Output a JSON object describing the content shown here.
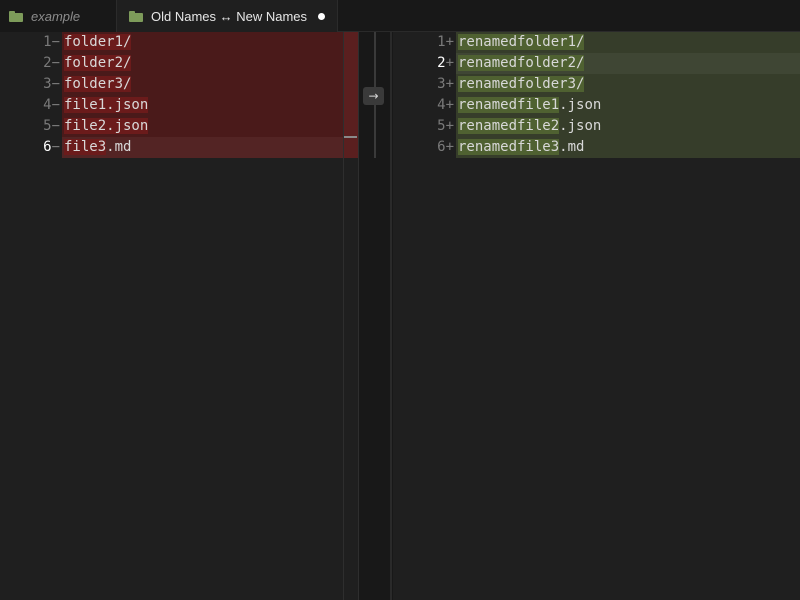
{
  "tabs": [
    {
      "label": "example",
      "icon": "folder-icon",
      "active": false
    },
    {
      "label": "Old Names ↔ New Names",
      "icon": "folder-icon",
      "active": true,
      "dirty": true
    }
  ],
  "left_pane": {
    "lines": [
      {
        "num": "1",
        "marker": "−",
        "pre": "",
        "hl": "folder1/",
        "post": ""
      },
      {
        "num": "2",
        "marker": "−",
        "pre": "",
        "hl": "folder2/",
        "post": ""
      },
      {
        "num": "3",
        "marker": "−",
        "pre": "",
        "hl": "folder3/",
        "post": ""
      },
      {
        "num": "4",
        "marker": "−",
        "pre": "",
        "hl": "file1.json",
        "post": ""
      },
      {
        "num": "5",
        "marker": "−",
        "pre": "",
        "hl": "file2.json",
        "post": ""
      },
      {
        "num": "6",
        "marker": "−",
        "pre": "",
        "hl": "file3",
        "post": ".md"
      }
    ],
    "active_line": 6
  },
  "right_pane": {
    "lines": [
      {
        "num": "1",
        "marker": "+",
        "pre": "",
        "hl": "renamedfolder1/",
        "post": ""
      },
      {
        "num": "2",
        "marker": "+",
        "pre": "",
        "hl": "renamedfolder2/",
        "post": ""
      },
      {
        "num": "3",
        "marker": "+",
        "pre": "",
        "hl": "renamedfolder3/",
        "post": ""
      },
      {
        "num": "4",
        "marker": "+",
        "pre": "renamedfile1",
        "hl": "",
        "post": ".json"
      },
      {
        "num": "5",
        "marker": "+",
        "pre": "renamedfile2",
        "hl": "",
        "post": ".json"
      },
      {
        "num": "6",
        "marker": "+",
        "pre": "renamedfile3",
        "hl": "",
        "post": ".md"
      }
    ],
    "active_line": 2
  },
  "apply_button": {
    "icon": "arrow-right-icon",
    "glyph": "→"
  },
  "colors": {
    "removed_bg": "#4a1a1a",
    "removed_highlight": "#6b1b1b",
    "added_bg": "#363d2a",
    "added_highlight": "#4f6131",
    "folder_icon": "#7d9b5a"
  }
}
